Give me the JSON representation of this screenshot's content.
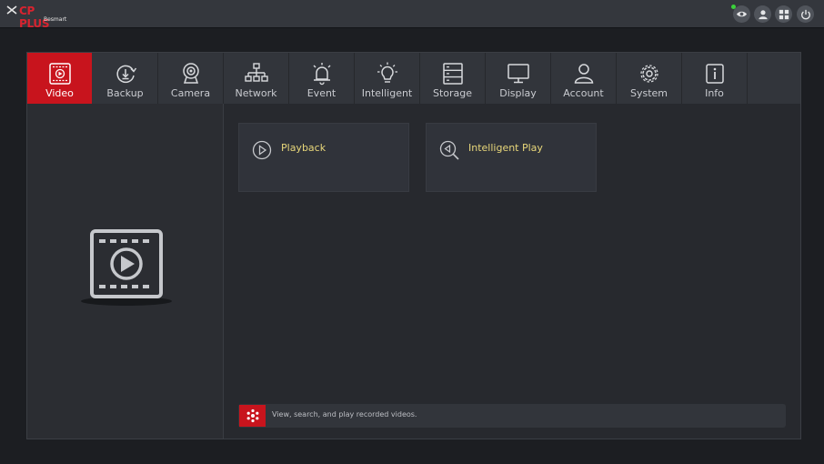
{
  "brand": {
    "name": "CP PLUS",
    "tagline": "Besmart"
  },
  "header_icons": [
    "eye-icon",
    "user-icon",
    "grid-icon",
    "power-icon"
  ],
  "tabs": [
    {
      "label": "Video",
      "icon": "video-play-icon",
      "active": true
    },
    {
      "label": "Backup",
      "icon": "backup-icon"
    },
    {
      "label": "Camera",
      "icon": "camera-icon"
    },
    {
      "label": "Network",
      "icon": "network-icon"
    },
    {
      "label": "Event",
      "icon": "event-alarm-icon"
    },
    {
      "label": "Intelligent",
      "icon": "intelligent-bulb-icon"
    },
    {
      "label": "Storage",
      "icon": "storage-icon"
    },
    {
      "label": "Display",
      "icon": "display-monitor-icon"
    },
    {
      "label": "Account",
      "icon": "account-icon"
    },
    {
      "label": "System",
      "icon": "gear-icon"
    },
    {
      "label": "Info",
      "icon": "info-icon"
    }
  ],
  "cards": [
    {
      "label": "Playback",
      "icon": "playback-icon"
    },
    {
      "label": "Intelligent Play",
      "icon": "intelligent-play-icon"
    }
  ],
  "info": {
    "text": "View, search, and play recorded videos."
  },
  "colors": {
    "accent": "#c8141d",
    "highlight_text": "#e8d77a",
    "background": "#27292e"
  }
}
